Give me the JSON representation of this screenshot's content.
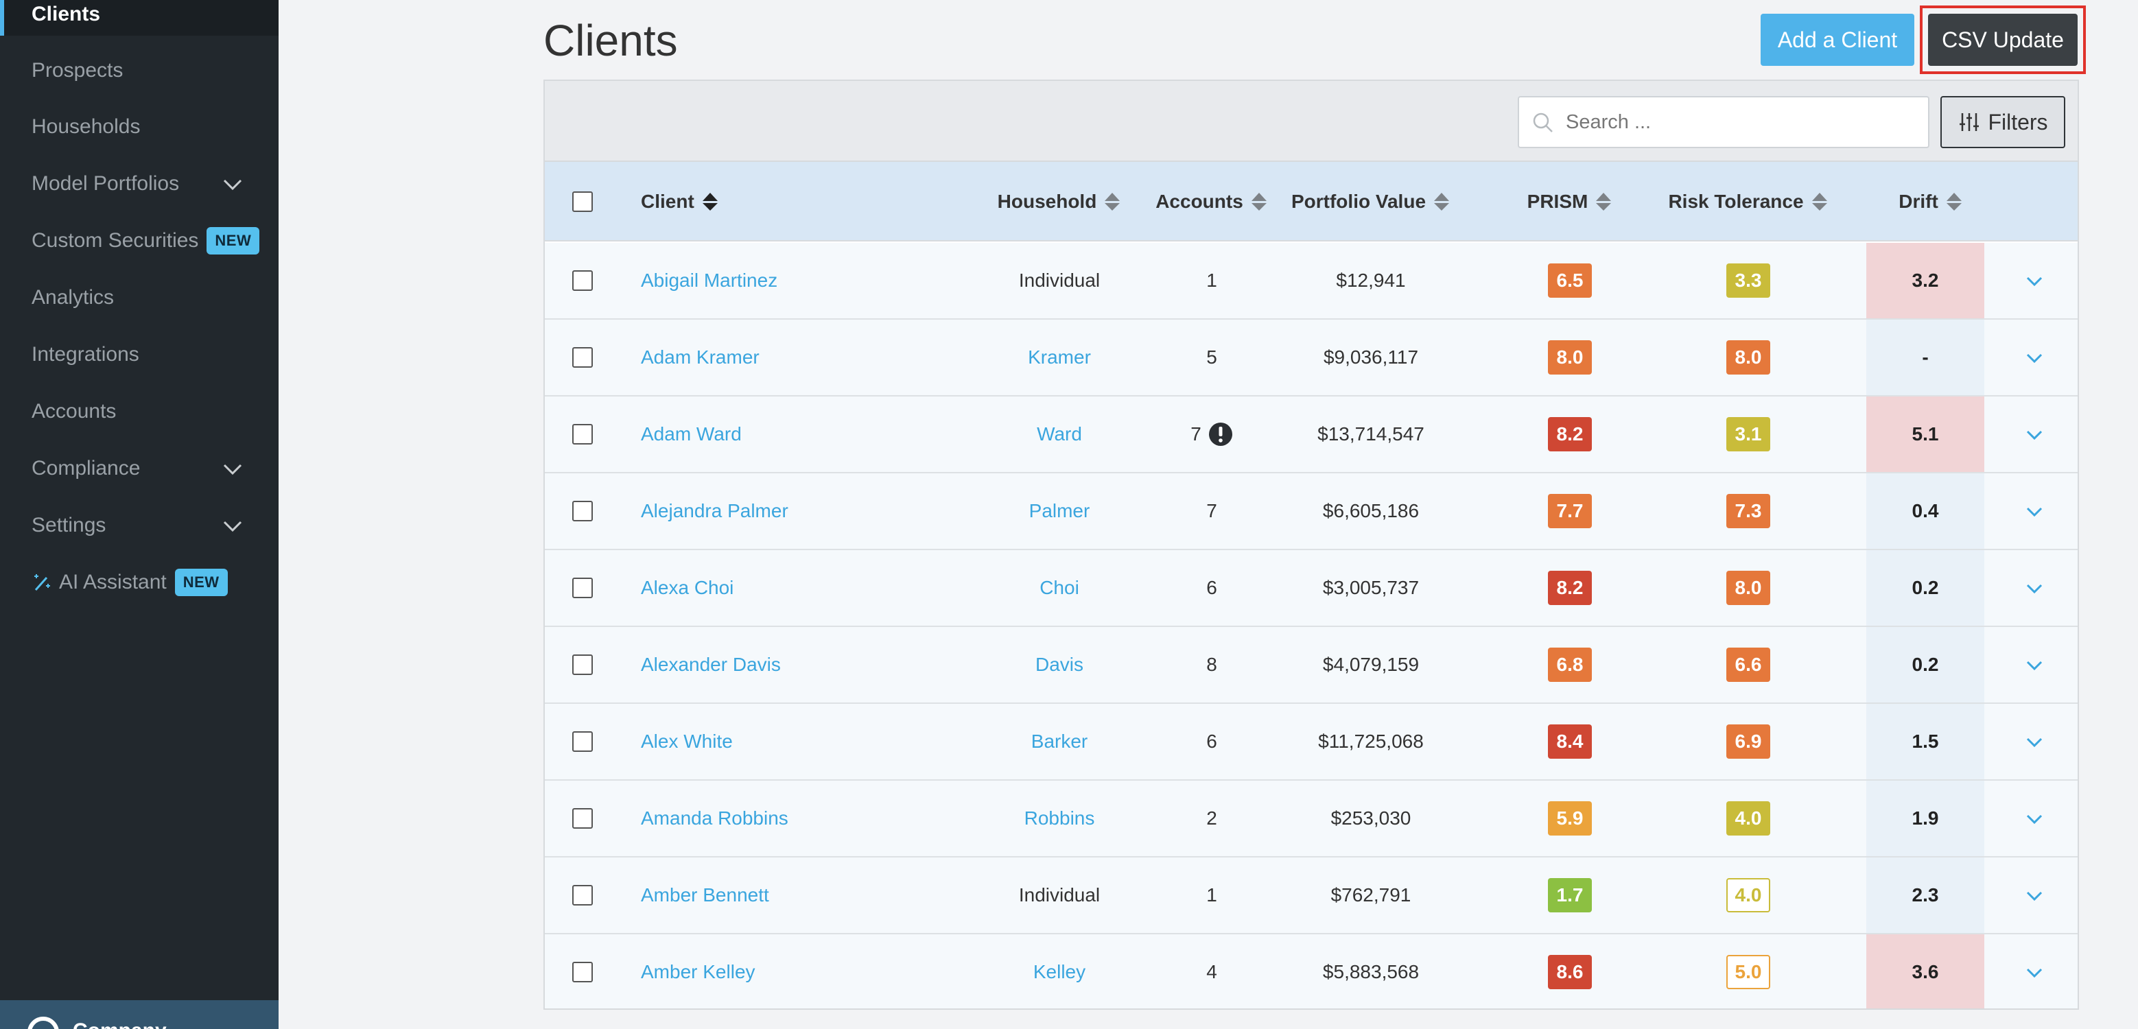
{
  "sidebar": {
    "items": [
      {
        "label": "Clients",
        "active": true
      },
      {
        "label": "Prospects"
      },
      {
        "label": "Households"
      },
      {
        "label": "Model Portfolios",
        "expandable": true
      },
      {
        "label": "Custom Securities",
        "badge": "NEW"
      },
      {
        "label": "Analytics"
      },
      {
        "label": "Integrations"
      },
      {
        "label": "Accounts"
      },
      {
        "label": "Compliance",
        "expandable": true
      },
      {
        "label": "Settings",
        "expandable": true
      },
      {
        "label": "AI Assistant",
        "badge": "NEW",
        "icon": "magic-wand-icon"
      }
    ],
    "footer_label": "Company"
  },
  "header": {
    "title": "Clients",
    "add_label": "Add a Client",
    "csv_label": "CSV Update"
  },
  "toolbar": {
    "search_placeholder": "Search ...",
    "filters_label": "Filters"
  },
  "columns": {
    "client": "Client",
    "household": "Household",
    "accounts": "Accounts",
    "portfolio_value": "Portfolio Value",
    "prism": "PRISM",
    "risk_tolerance": "Risk Tolerance",
    "drift": "Drift"
  },
  "colors": {
    "accent": "#4fb3ea",
    "link": "#3aa5de",
    "drift_high_bg": "#f1d4d6",
    "score_green": "#8cc042",
    "score_orange_light": "#eba33b",
    "score_orange": "#e5783b",
    "score_red": "#cf4733",
    "score_olive": "#c9bc3a"
  },
  "rows": [
    {
      "client": "Abigail Martinez",
      "household": "Individual",
      "household_link": false,
      "accounts": "1",
      "warning": false,
      "value": "$12,941",
      "prism": "6.5",
      "prism_color": "#e5783b",
      "risk": "3.3",
      "risk_color": "#c9bc3a",
      "risk_outline": false,
      "drift": "3.2",
      "drift_high": true
    },
    {
      "client": "Adam Kramer",
      "household": "Kramer",
      "household_link": true,
      "accounts": "5",
      "warning": false,
      "value": "$9,036,117",
      "prism": "8.0",
      "prism_color": "#e5783b",
      "risk": "8.0",
      "risk_color": "#e5783b",
      "risk_outline": false,
      "drift": "-",
      "drift_high": false
    },
    {
      "client": "Adam Ward",
      "household": "Ward",
      "household_link": true,
      "accounts": "7",
      "warning": true,
      "value": "$13,714,547",
      "prism": "8.2",
      "prism_color": "#cf4733",
      "risk": "3.1",
      "risk_color": "#c9bc3a",
      "risk_outline": false,
      "drift": "5.1",
      "drift_high": true
    },
    {
      "client": "Alejandra Palmer",
      "household": "Palmer",
      "household_link": true,
      "accounts": "7",
      "warning": false,
      "value": "$6,605,186",
      "prism": "7.7",
      "prism_color": "#e5783b",
      "risk": "7.3",
      "risk_color": "#e5783b",
      "risk_outline": false,
      "drift": "0.4",
      "drift_high": false
    },
    {
      "client": "Alexa Choi",
      "household": "Choi",
      "household_link": true,
      "accounts": "6",
      "warning": false,
      "value": "$3,005,737",
      "prism": "8.2",
      "prism_color": "#cf4733",
      "risk": "8.0",
      "risk_color": "#e5783b",
      "risk_outline": false,
      "drift": "0.2",
      "drift_high": false
    },
    {
      "client": "Alexander Davis",
      "household": "Davis",
      "household_link": true,
      "accounts": "8",
      "warning": false,
      "value": "$4,079,159",
      "prism": "6.8",
      "prism_color": "#e5783b",
      "risk": "6.6",
      "risk_color": "#e5783b",
      "risk_outline": false,
      "drift": "0.2",
      "drift_high": false
    },
    {
      "client": "Alex White",
      "household": "Barker",
      "household_link": true,
      "accounts": "6",
      "warning": false,
      "value": "$11,725,068",
      "prism": "8.4",
      "prism_color": "#cf4733",
      "risk": "6.9",
      "risk_color": "#e5783b",
      "risk_outline": false,
      "drift": "1.5",
      "drift_high": false
    },
    {
      "client": "Amanda Robbins",
      "household": "Robbins",
      "household_link": true,
      "accounts": "2",
      "warning": false,
      "value": "$253,030",
      "prism": "5.9",
      "prism_color": "#eba33b",
      "risk": "4.0",
      "risk_color": "#c9bc3a",
      "risk_outline": false,
      "drift": "1.9",
      "drift_high": false
    },
    {
      "client": "Amber Bennett",
      "household": "Individual",
      "household_link": false,
      "accounts": "1",
      "warning": false,
      "value": "$762,791",
      "prism": "1.7",
      "prism_color": "#8cc042",
      "risk": "4.0",
      "risk_color": "#c9bc3a",
      "risk_outline": true,
      "drift": "2.3",
      "drift_high": false
    },
    {
      "client": "Amber Kelley",
      "household": "Kelley",
      "household_link": true,
      "accounts": "4",
      "warning": false,
      "value": "$5,883,568",
      "prism": "8.6",
      "prism_color": "#cf4733",
      "risk": "5.0",
      "risk_color": "#eba33b",
      "risk_outline": true,
      "drift": "3.6",
      "drift_high": true
    }
  ]
}
